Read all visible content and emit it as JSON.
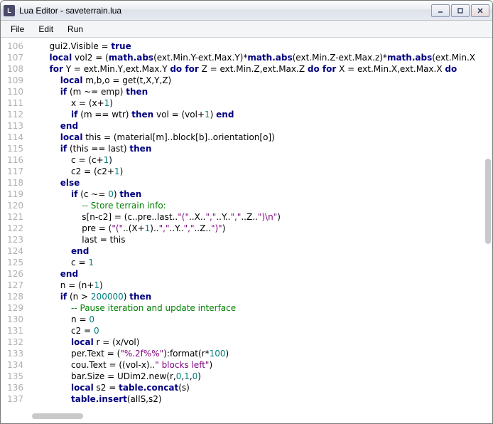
{
  "window": {
    "title": "Lua Editor - saveterrain.lua"
  },
  "menu": {
    "file": "File",
    "edit": "Edit",
    "run": "Run"
  },
  "gutter": {
    "start": 106,
    "end": 137
  },
  "code": [
    [
      [
        "",
        2
      ],
      [
        "gui2.Visible = ",
        0
      ],
      [
        "true",
        1
      ]
    ],
    [
      [
        "",
        2
      ],
      [
        "local",
        1
      ],
      [
        " vol2 = (",
        0
      ],
      [
        "math.abs",
        1
      ],
      [
        "(ext.Min.Y-ext.Max.Y)*",
        0
      ],
      [
        "math.abs",
        1
      ],
      [
        "(ext.Min.Z-ext.Max.z)*",
        0
      ],
      [
        "math.abs",
        1
      ],
      [
        "(ext.Min.X",
        0
      ]
    ],
    [
      [
        "",
        2
      ],
      [
        "for",
        1
      ],
      [
        " Y = ext.Min.Y,ext.Max.Y ",
        0
      ],
      [
        "do for",
        1
      ],
      [
        " Z = ext.Min.Z,ext.Max.Z ",
        0
      ],
      [
        "do for",
        1
      ],
      [
        " X = ext.Min.X,ext.Max.X ",
        0
      ],
      [
        "do",
        1
      ]
    ],
    [
      [
        "",
        4
      ],
      [
        "local",
        1
      ],
      [
        " m,b,o = get(t,X,Y,Z)",
        0
      ]
    ],
    [
      [
        "",
        4
      ],
      [
        "if",
        1
      ],
      [
        " (m ~= emp) ",
        0
      ],
      [
        "then",
        1
      ]
    ],
    [
      [
        "",
        6
      ],
      [
        "x = (x+",
        0
      ],
      [
        "1",
        2
      ],
      [
        ")",
        0
      ]
    ],
    [
      [
        "",
        6
      ],
      [
        "if",
        1
      ],
      [
        " (m == wtr) ",
        0
      ],
      [
        "then",
        1
      ],
      [
        " vol = (vol+",
        0
      ],
      [
        "1",
        2
      ],
      [
        ") ",
        0
      ],
      [
        "end",
        1
      ]
    ],
    [
      [
        "",
        4
      ],
      [
        "end",
        1
      ]
    ],
    [
      [
        "",
        4
      ],
      [
        "local",
        1
      ],
      [
        " this = (material[m]..block[b]..orientation[o])",
        0
      ]
    ],
    [
      [
        "",
        4
      ],
      [
        "if",
        1
      ],
      [
        " (this == last) ",
        0
      ],
      [
        "then",
        1
      ]
    ],
    [
      [
        "",
        6
      ],
      [
        "c = (c+",
        0
      ],
      [
        "1",
        2
      ],
      [
        ")",
        0
      ]
    ],
    [
      [
        "",
        6
      ],
      [
        "c2 = (c2+",
        0
      ],
      [
        "1",
        2
      ],
      [
        ")",
        0
      ]
    ],
    [
      [
        "",
        4
      ],
      [
        "else",
        1
      ]
    ],
    [
      [
        "",
        6
      ],
      [
        "if",
        1
      ],
      [
        " (c ~= ",
        0
      ],
      [
        "0",
        2
      ],
      [
        ") ",
        0
      ],
      [
        "then",
        1
      ]
    ],
    [
      [
        "",
        8
      ],
      [
        "-- Store terrain info:",
        3
      ]
    ],
    [
      [
        "",
        8
      ],
      [
        "s[n-c2] = (c..pre..last..",
        0
      ],
      [
        "\"(\"",
        4
      ],
      [
        "..X..",
        0
      ],
      [
        "\",\"",
        4
      ],
      [
        "..Y..",
        0
      ],
      [
        "\",\"",
        4
      ],
      [
        "..Z..",
        0
      ],
      [
        "\")\\n\"",
        4
      ],
      [
        ")",
        0
      ]
    ],
    [
      [
        "",
        8
      ],
      [
        "pre = (",
        0
      ],
      [
        "\"(\"",
        4
      ],
      [
        "..(X+",
        0
      ],
      [
        "1",
        2
      ],
      [
        ")..",
        0
      ],
      [
        "\",\"",
        4
      ],
      [
        "..Y..",
        0
      ],
      [
        "\",\"",
        4
      ],
      [
        "..Z..",
        0
      ],
      [
        "\")\"",
        4
      ],
      [
        ")",
        0
      ]
    ],
    [
      [
        "",
        8
      ],
      [
        "last = this",
        0
      ]
    ],
    [
      [
        "",
        6
      ],
      [
        "end",
        1
      ]
    ],
    [
      [
        "",
        6
      ],
      [
        "c = ",
        0
      ],
      [
        "1",
        2
      ]
    ],
    [
      [
        "",
        4
      ],
      [
        "end",
        1
      ]
    ],
    [
      [
        "",
        4
      ],
      [
        "n = (n+",
        0
      ],
      [
        "1",
        2
      ],
      [
        ")",
        0
      ]
    ],
    [
      [
        "",
        4
      ],
      [
        "if",
        1
      ],
      [
        " (n > ",
        0
      ],
      [
        "200000",
        2
      ],
      [
        ") ",
        0
      ],
      [
        "then",
        1
      ]
    ],
    [
      [
        "",
        6
      ],
      [
        "-- Pause iteration and update interface",
        3
      ]
    ],
    [
      [
        "",
        6
      ],
      [
        "n = ",
        0
      ],
      [
        "0",
        2
      ]
    ],
    [
      [
        "",
        6
      ],
      [
        "c2 = ",
        0
      ],
      [
        "0",
        2
      ]
    ],
    [
      [
        "",
        6
      ],
      [
        "local",
        1
      ],
      [
        " r = (x/vol)",
        0
      ]
    ],
    [
      [
        "",
        6
      ],
      [
        "per.Text = (",
        0
      ],
      [
        "\"%.2f%%\"",
        4
      ],
      [
        "):format(r*",
        0
      ],
      [
        "100",
        2
      ],
      [
        ")",
        0
      ]
    ],
    [
      [
        "",
        6
      ],
      [
        "cou.Text = ((vol-x)..",
        0
      ],
      [
        "\" blocks left\"",
        4
      ],
      [
        ")",
        0
      ]
    ],
    [
      [
        "",
        6
      ],
      [
        "bar.Size = UDim2.new(r,",
        0
      ],
      [
        "0",
        2
      ],
      [
        ",",
        0
      ],
      [
        "1",
        2
      ],
      [
        ",",
        0
      ],
      [
        "0",
        2
      ],
      [
        ")",
        0
      ]
    ],
    [
      [
        "",
        6
      ],
      [
        "local",
        1
      ],
      [
        " s2 = ",
        0
      ],
      [
        "table.concat",
        1
      ],
      [
        "(s)",
        0
      ]
    ],
    [
      [
        "",
        6
      ],
      [
        "table.insert",
        1
      ],
      [
        "(allS,s2)",
        0
      ]
    ]
  ]
}
